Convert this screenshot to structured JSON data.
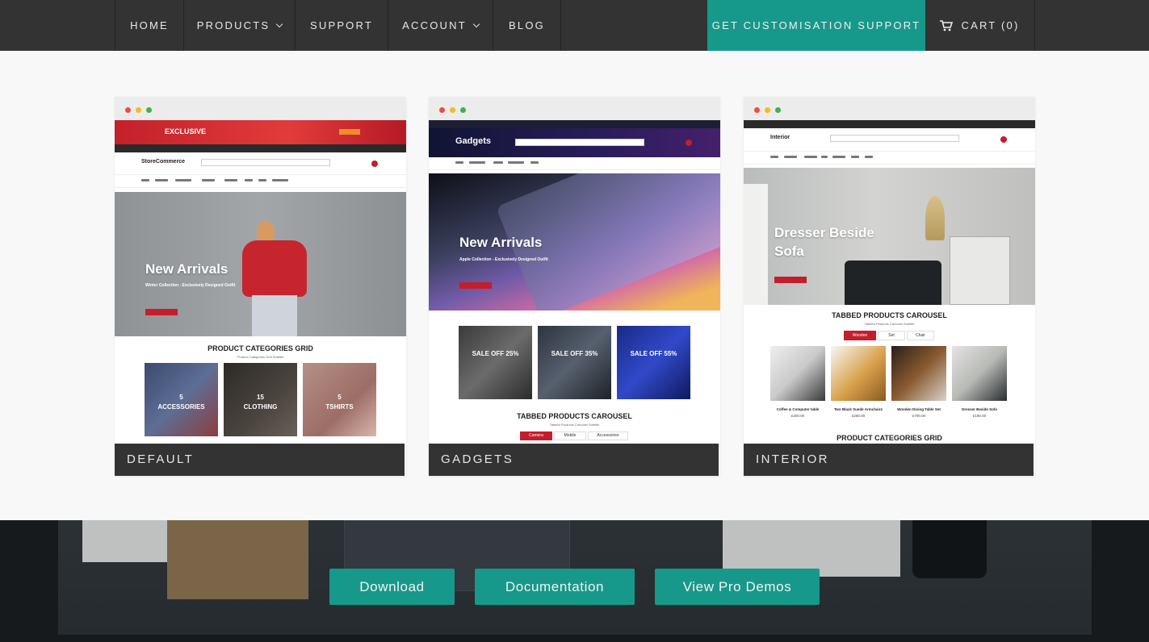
{
  "nav": {
    "items": [
      {
        "label": "HOME",
        "has_dropdown": false
      },
      {
        "label": "PRODUCTS",
        "has_dropdown": true
      },
      {
        "label": "SUPPORT",
        "has_dropdown": false
      },
      {
        "label": "ACCOUNT",
        "has_dropdown": true
      },
      {
        "label": "BLOG",
        "has_dropdown": false
      }
    ],
    "cta_label": "GET CUSTOMISATION SUPPORT",
    "cart_label": "CART (0)",
    "cart_icon": "cart-icon",
    "accent_color": "#16988a"
  },
  "demos": [
    {
      "label": "DEFAULT",
      "promo": "EXCLUSIVE",
      "site_name": "StoreCommerce",
      "hero_title": "New Arrivals",
      "hero_subtitle": "Winter Collection - Exclusively Designed Outfit",
      "section_title": "PRODUCT CATEGORIES GRID",
      "section_subtitle": "Product Categories Grid Subtitle",
      "tiles": [
        {
          "count": "5",
          "name": "ACCESSORIES"
        },
        {
          "count": "15",
          "name": "CLOTHING"
        },
        {
          "count": "5",
          "name": "TSHIRTS"
        }
      ]
    },
    {
      "label": "GADGETS",
      "site_name": "Gadgets",
      "hero_title": "New Arrivals",
      "hero_subtitle": "Apple Collection - Exclusively Designed Outfit",
      "tiles": [
        {
          "name": "SALE OFF 25%"
        },
        {
          "name": "SALE OFF 35%"
        },
        {
          "name": "SALE OFF 55%"
        }
      ],
      "section_title": "TABBED PRODUCTS CAROUSEL",
      "section_subtitle": "Tabbed Products Carousel Subtitle",
      "tabs": [
        "Camera",
        "Mobile",
        "Accessories"
      ]
    },
    {
      "label": "INTERIOR",
      "site_name": "Interior",
      "hero_title_line1": "Dresser Beside",
      "hero_title_line2": "Sofa",
      "section_title": "TABBED PRODUCTS CAROUSEL",
      "section_subtitle": "Tabbed Products Carousel Subtitle",
      "tabs": [
        "Wooden",
        "Set",
        "Chair"
      ],
      "products": [
        {
          "name": "Coffee & Computer table",
          "price": "£200.00"
        },
        {
          "name": "Two Black Suede Armchairs",
          "price": "£250.00"
        },
        {
          "name": "Wooden Dining Table Set",
          "price": "£700.00"
        },
        {
          "name": "Dresser Beside Sofa",
          "price": "£190.00"
        }
      ],
      "section2_title": "PRODUCT CATEGORIES GRID"
    }
  ],
  "buttons": {
    "download": "Download",
    "documentation": "Documentation",
    "pro_demos": "View Pro Demos"
  }
}
